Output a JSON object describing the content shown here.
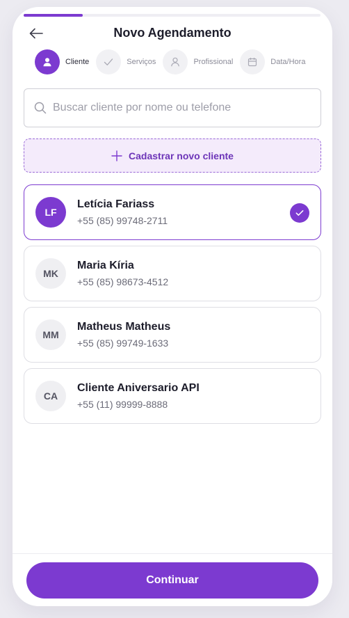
{
  "header": {
    "title": "Novo Agendamento",
    "progress_fraction": 0.2
  },
  "steps": [
    {
      "label": "Cliente",
      "icon": "user-icon",
      "active": true
    },
    {
      "label": "Serviços",
      "icon": "check-icon",
      "active": false
    },
    {
      "label": "Profissional",
      "icon": "user-icon",
      "active": false
    },
    {
      "label": "Data/Hora",
      "icon": "calendar-icon",
      "active": false
    }
  ],
  "search": {
    "placeholder": "Buscar cliente por nome ou telefone",
    "value": ""
  },
  "new_client": {
    "label": "Cadastrar novo cliente"
  },
  "clients": [
    {
      "initials": "LF",
      "name": "Letícia Fariass",
      "phone": "+55 (85) 99748-2711",
      "selected": true
    },
    {
      "initials": "MK",
      "name": "Maria Kíria",
      "phone": "+55 (85) 98673-4512",
      "selected": false
    },
    {
      "initials": "MM",
      "name": "Matheus Matheus",
      "phone": "+55 (85) 99749-1633",
      "selected": false
    },
    {
      "initials": "CA",
      "name": "Cliente Aniversario API",
      "phone": "+55 (11) 99999-8888",
      "selected": false
    }
  ],
  "footer": {
    "continue_label": "Continuar"
  },
  "colors": {
    "accent": "#7c3ad0",
    "accent_light": "#f4ebfb",
    "background": "#ecebf1"
  }
}
